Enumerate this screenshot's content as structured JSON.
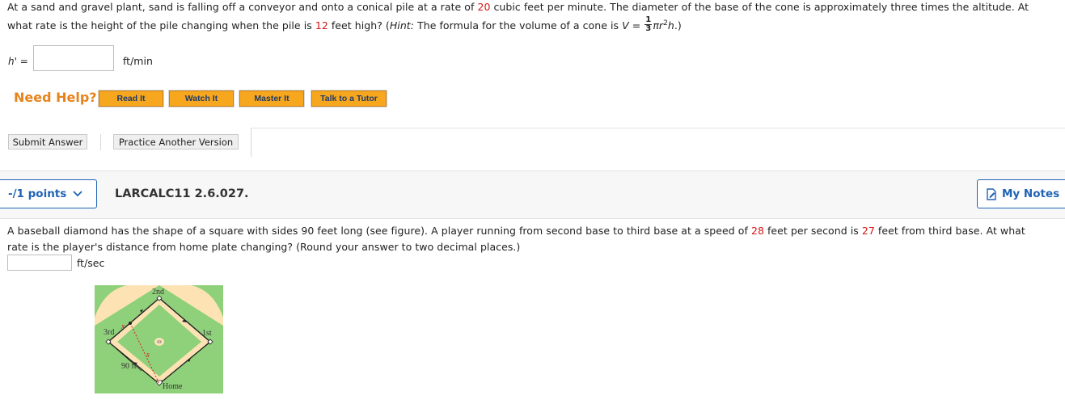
{
  "question1": {
    "line1_parts": [
      {
        "text": "At a sand and gravel plant, sand is falling off a conveyor and onto a conical pile at a rate of ",
        "style": "normal"
      },
      {
        "text": "20",
        "style": "red"
      },
      {
        "text": " cubic feet per minute. The diameter of the base of the cone is approximately three times the altitude. At",
        "style": "normal"
      }
    ],
    "line2_parts": [
      {
        "text": "what rate is the height of the pile changing when the pile is ",
        "style": "normal"
      },
      {
        "text": "12",
        "style": "red"
      },
      {
        "text": " feet high? (",
        "style": "normal"
      },
      {
        "text": "Hint:",
        "style": "italic"
      },
      {
        "text": " The formula for the volume of a cone is ",
        "style": "normal"
      }
    ],
    "formula": {
      "lhs": "V =",
      "frac_num": "1",
      "frac_den": "3",
      "pi_r": "πr",
      "exp": "2",
      "h": "h",
      "close": ".)"
    },
    "answer_label": "h' =",
    "answer_value": "",
    "unit": "ft/min"
  },
  "help": {
    "label": "Need Help?",
    "buttons": [
      "Read It",
      "Watch It",
      "Master It",
      "Talk to a Tutor"
    ]
  },
  "actions": {
    "submit": "Submit Answer",
    "practice": "Practice Another Version"
  },
  "question2": {
    "points": "-/1 points",
    "id": "LARCALC11 2.6.027.",
    "notes": "My Notes",
    "line1_parts": [
      {
        "text": "A baseball diamond has the shape of a square with sides 90 feet long (see figure). A player running from second base to third base at a speed of ",
        "style": "normal"
      },
      {
        "text": "28",
        "style": "red"
      },
      {
        "text": " feet per second is ",
        "style": "normal"
      },
      {
        "text": "27",
        "style": "red"
      },
      {
        "text": " feet from third base. At what",
        "style": "normal"
      }
    ],
    "line2": "rate is the player's distance from home plate changing? (Round your answer to two decimal places.)",
    "answer_value": "",
    "unit": "ft/sec",
    "figure": {
      "labels": {
        "second": "2nd",
        "third": "3rd",
        "first": "1st",
        "home": "Home",
        "side": "90 ft",
        "x": "x",
        "s": "s"
      },
      "colors": {
        "grass": "#8fd07a",
        "dirt": "#fde3b4",
        "lines": "#222222",
        "dashed": "#d42020"
      }
    }
  }
}
